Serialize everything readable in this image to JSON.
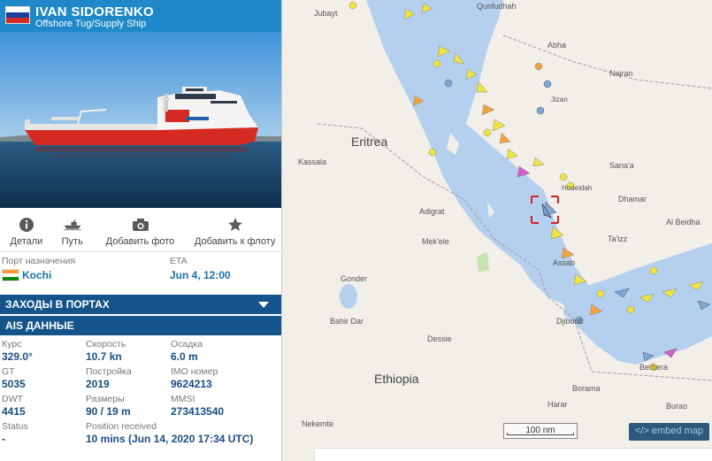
{
  "vessel": {
    "name": "IVAN SIDORENKO",
    "type": "Offshore Tug/Supply Ship",
    "flag_colors": [
      "#ffffff",
      "#1c3f9e",
      "#d52b1e"
    ]
  },
  "actions": [
    {
      "label": "Детали",
      "icon": "info-icon"
    },
    {
      "label": "Путь",
      "icon": "ship-track-icon"
    },
    {
      "label": "Добавить фото",
      "icon": "camera-icon"
    },
    {
      "label": "Добавить к флоту",
      "icon": "star-icon"
    }
  ],
  "destination": {
    "label": "Порт назначения",
    "port": "Kochi",
    "flag_colors": [
      "#ff9933",
      "#ffffff",
      "#138808"
    ],
    "eta_label": "ETA",
    "eta": "Jun 4, 12:00"
  },
  "sections": {
    "ports": "ЗАХОДЫ В ПОРТАХ",
    "ais": "AIS ДАННЫЕ"
  },
  "ais": {
    "course_label": "Курс",
    "course": "329.0°",
    "speed_label": "Скорость",
    "speed": "10.7 kn",
    "draught_label": "Осадка",
    "draught": "6.0 m",
    "gt_label": "GT",
    "gt": "5035",
    "built_label": "Постройка",
    "built": "2019",
    "imo_label": "IMO номер",
    "imo": "9624213",
    "dwt_label": "DWT",
    "dwt": "4415",
    "size_label": "Размеры",
    "size": "90 / 19 m",
    "mmsi_label": "MMSI",
    "mmsi": "273413540",
    "status_label": "Status",
    "status": "-",
    "received_label": "Position received",
    "received": "10 mins (Jun 14, 2020 17:34 UTC)"
  },
  "map": {
    "places": {
      "jubayt": "Jubayt",
      "qunfudhah": "Qunfudhah",
      "abha": "Abha",
      "najran": "Najran",
      "eritrea": "Eritrea",
      "kassala": "Kassala",
      "sanaa": "Sana'a",
      "hodeidah": "Hodeidah",
      "dhamar": "Dhamar",
      "adigrat": "Adigrat",
      "albeidha": "Al Beidha",
      "mekele": "Mek'ele",
      "taizz": "Ta'izz",
      "assab": "Assab",
      "gonder": "Gonder",
      "bahirdar": "Bahir Dar",
      "djibouti": "Djibouti",
      "dessie": "Dessie",
      "ethiopia": "Ethiopia",
      "berbera": "Berbera",
      "borama": "Borama",
      "burao": "Burao",
      "nekemte": "Nekemte",
      "harar": "Harar",
      "jizan": "Jizan"
    },
    "scale": "100 nm",
    "embed": "</> embed map",
    "colors": {
      "sea": "#b5d0ee",
      "land": "#f2efe9",
      "target": "#d32027"
    }
  }
}
